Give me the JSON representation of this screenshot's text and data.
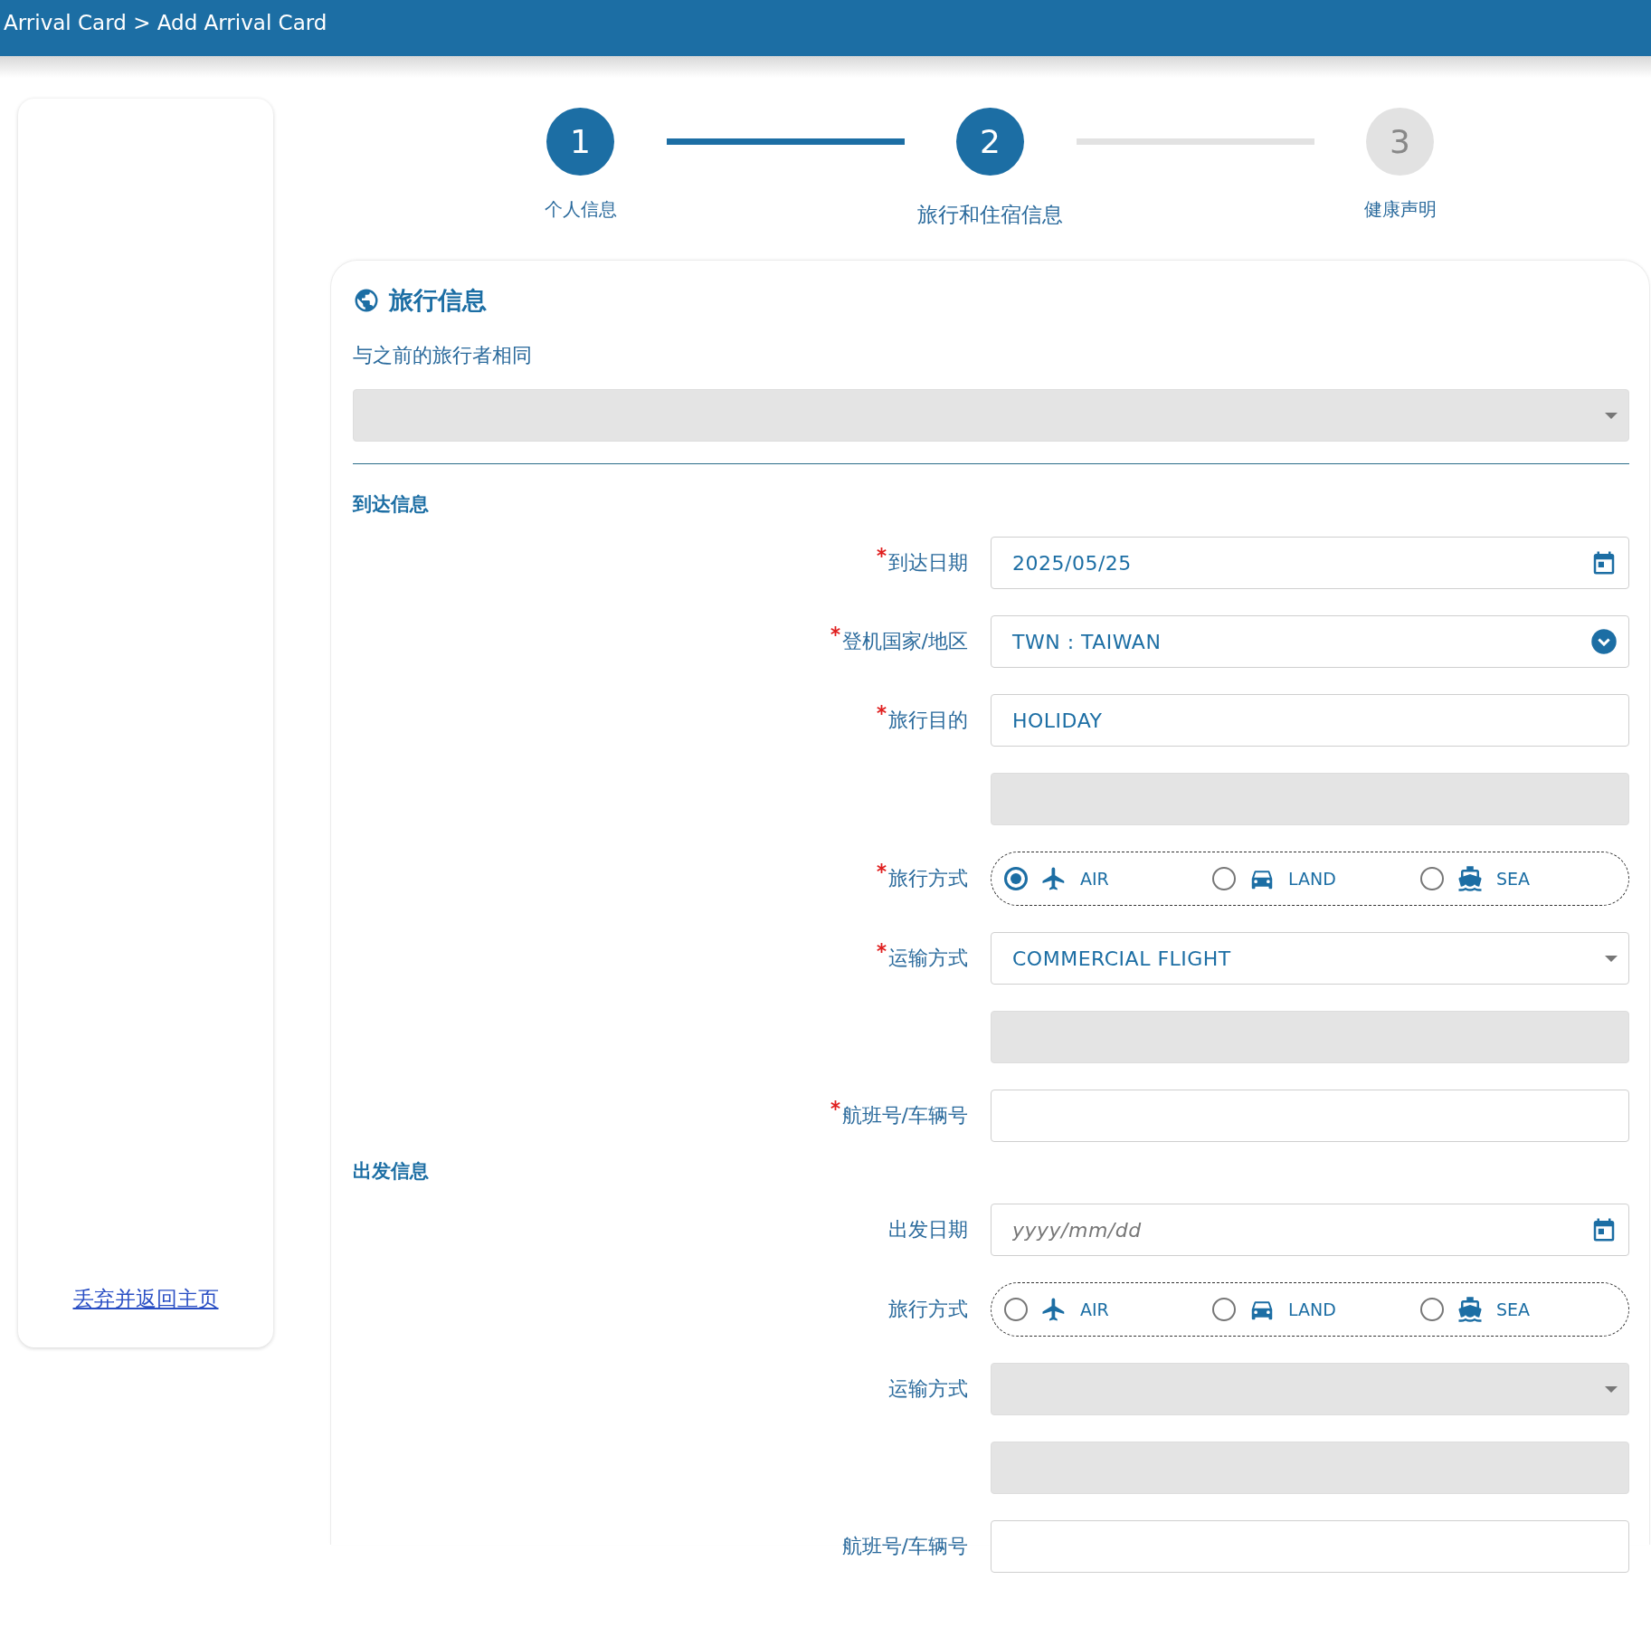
{
  "header": {
    "breadcrumb": "Arrival Card > Add Arrival Card"
  },
  "sidebar": {
    "link": "丢弃并返回主页"
  },
  "stepper": {
    "steps": [
      {
        "number": "1",
        "label": "个人信息",
        "reached": true,
        "selected": false
      },
      {
        "number": "2",
        "label": "旅行和住宿信息",
        "reached": true,
        "selected": true
      },
      {
        "number": "3",
        "label": "健康声明",
        "reached": false,
        "selected": false
      }
    ]
  },
  "section": {
    "title": "旅行信息",
    "same_as_label": "与之前的旅行者相同",
    "same_as_select": {
      "disabled": true
    },
    "groups": [
      {
        "title": "到达信息",
        "fields": [
          {
            "kind": "date",
            "label": "到达日期",
            "required": true,
            "disabled": false,
            "value": "2025/05/25"
          },
          {
            "kind": "combobox",
            "label": "登机国家/地区",
            "required": true,
            "disabled": false,
            "value": "TWN : TAIWAN"
          },
          {
            "kind": "text",
            "label": "旅行目的",
            "required": true,
            "disabled": false,
            "value": "HOLIDAY"
          },
          {
            "kind": "text",
            "disabled": true
          },
          {
            "kind": "radio",
            "label": "旅行方式",
            "required": true,
            "options": [
              {
                "kind": "air",
                "label": "AIR",
                "selected": true
              },
              {
                "kind": "land",
                "label": "LAND",
                "selected": false
              },
              {
                "kind": "sea",
                "label": "SEA",
                "selected": false
              }
            ]
          },
          {
            "kind": "select",
            "label": "运输方式",
            "required": true,
            "disabled": false,
            "value": "COMMERCIAL FLIGHT"
          },
          {
            "kind": "text",
            "disabled": true
          },
          {
            "kind": "text",
            "label": "航班号/车辆号",
            "required": true,
            "disabled": false
          }
        ]
      },
      {
        "title": "出发信息",
        "fields": [
          {
            "kind": "date",
            "label": "出发日期",
            "required": false,
            "disabled": false,
            "placeholder": "yyyy/mm/dd"
          },
          {
            "kind": "radio",
            "label": "旅行方式",
            "required": false,
            "options": [
              {
                "kind": "air",
                "label": "AIR",
                "selected": false
              },
              {
                "kind": "land",
                "label": "LAND",
                "selected": false
              },
              {
                "kind": "sea",
                "label": "SEA",
                "selected": false
              }
            ]
          },
          {
            "kind": "select",
            "label": "运输方式",
            "required": false,
            "disabled": true
          },
          {
            "kind": "text",
            "disabled": true
          },
          {
            "kind": "text",
            "label": "航班号/车辆号",
            "required": false,
            "disabled": false
          }
        ]
      }
    ]
  }
}
